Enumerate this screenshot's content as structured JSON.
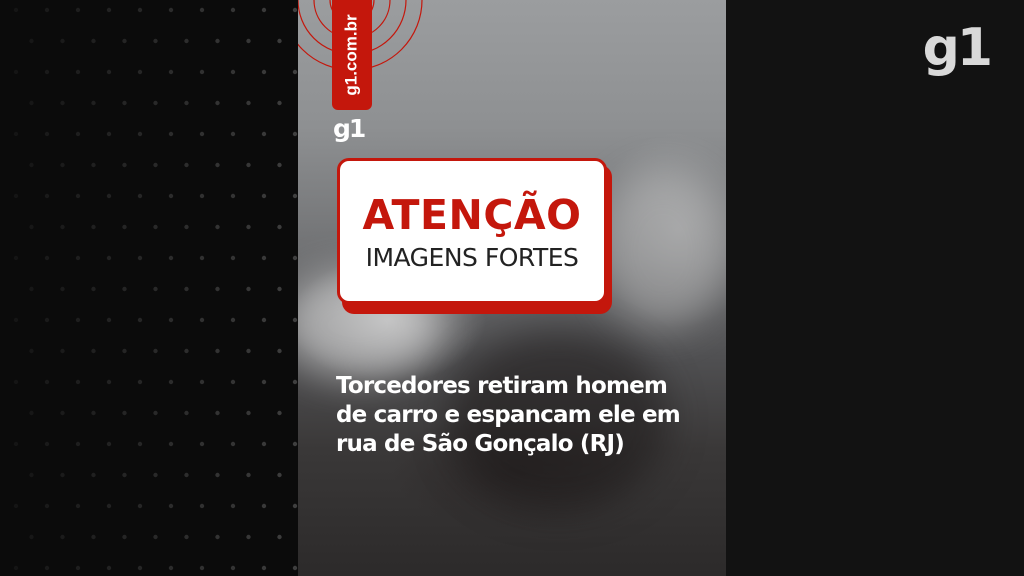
{
  "brand": {
    "logo_text": "g1",
    "small_logo_text": "g1",
    "source_tag": "g1.com.br",
    "accent_color": "#c4170c"
  },
  "warning": {
    "title": "ATENÇÃO",
    "subtitle": "IMAGENS FORTES"
  },
  "caption": {
    "lines": [
      "Torcedores retiram homem",
      "de carro e espancam ele em",
      "rua de  São Gonçalo (RJ)"
    ]
  }
}
